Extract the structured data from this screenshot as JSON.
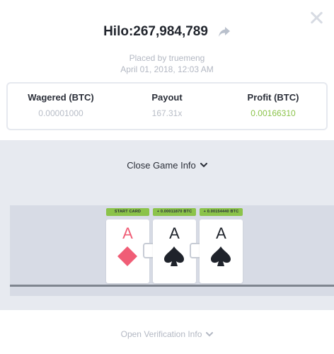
{
  "header": {
    "title": "Hilo:267,984,789",
    "placed_by": "Placed by truemeng",
    "date": "April 01, 2018, 12:03 AM"
  },
  "stats": [
    {
      "label": "Wagered (BTC)",
      "value": "0.00001000"
    },
    {
      "label": "Payout",
      "value": "167.31x"
    },
    {
      "label": "Profit (BTC)",
      "value": "0.00166310"
    }
  ],
  "game_info": {
    "toggle_label": "Close Game Info"
  },
  "cards": [
    {
      "badge": "START CARD",
      "rank": "A",
      "suit": "diamond-icon"
    },
    {
      "badge": "+ 0.00011870 BTC",
      "rank": "A",
      "suit": "spade-icon"
    },
    {
      "badge": "+ 0.00154440 BTC",
      "rank": "A",
      "suit": "spade-icon"
    }
  ],
  "verification": {
    "toggle_label": "Open Verification Info"
  },
  "colors": {
    "profit": "#8bc34a",
    "red_suit": "#f05d76",
    "panel_bg": "#e7eaf0"
  }
}
